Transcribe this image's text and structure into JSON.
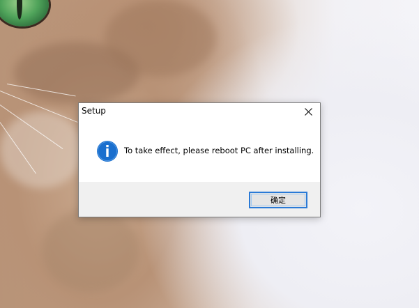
{
  "dialog": {
    "title": "Setup",
    "message": "To take effect, please reboot PC after installing.",
    "icon": "info-icon",
    "ok_label": "确定",
    "close_icon": "close-icon"
  },
  "colors": {
    "accent": "#2a7ad6",
    "info_icon": "#1a6fce",
    "footer_bg": "#f0f0f0"
  }
}
